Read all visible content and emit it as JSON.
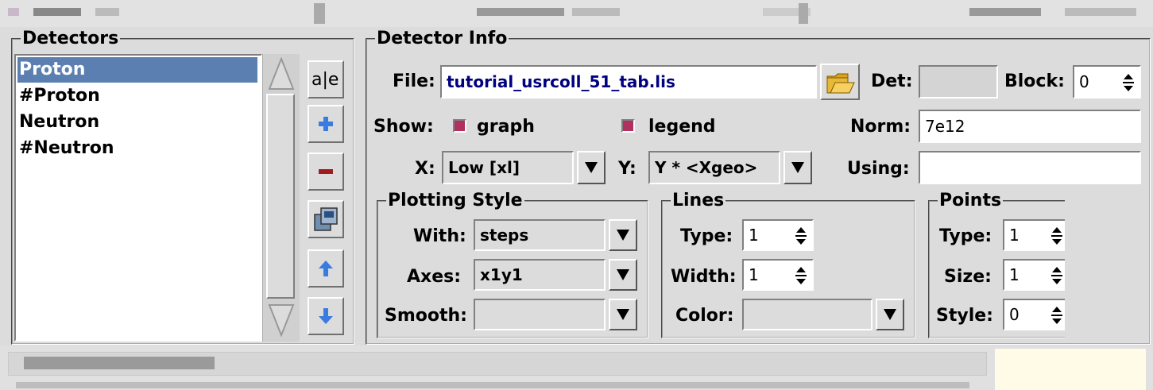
{
  "detectors": {
    "title": "Detectors",
    "items": [
      "Proton",
      "#Proton",
      "Neutron",
      "#Neutron"
    ],
    "selected_index": 0,
    "buttons": {
      "rename_text": "a|e"
    }
  },
  "detector_info": {
    "title": "Detector Info",
    "file_label": "File:",
    "file_value": "tutorial_usrcoll_51_tab.lis",
    "det_label": "Det:",
    "det_value": "",
    "block_label": "Block:",
    "block_value": "0",
    "show_label": "Show:",
    "graph_label": "graph",
    "graph_checked": true,
    "legend_label": "legend",
    "legend_checked": true,
    "norm_label": "Norm:",
    "norm_value": "7e12",
    "x_label": "X:",
    "x_value": "Low [xl]",
    "y_label": "Y:",
    "y_value": "Y * <Xgeo>",
    "using_label": "Using:",
    "using_value": ""
  },
  "plotting_style": {
    "title": "Plotting Style",
    "with_label": "With:",
    "with_value": "steps",
    "axes_label": "Axes:",
    "axes_value": "x1y1",
    "smooth_label": "Smooth:",
    "smooth_value": ""
  },
  "lines": {
    "title": "Lines",
    "type_label": "Type:",
    "type_value": "1",
    "width_label": "Width:",
    "width_value": "1",
    "color_label": "Color:",
    "color_value": ""
  },
  "points": {
    "title": "Points",
    "type_label": "Type:",
    "type_value": "1",
    "size_label": "Size:",
    "size_value": "1",
    "style_label": "Style:",
    "style_value": "0"
  },
  "colors": {
    "selection": "#5a7fb0",
    "file_text": "#00007f",
    "checkbox": "#b03060",
    "status_right": "#fffbe6"
  }
}
